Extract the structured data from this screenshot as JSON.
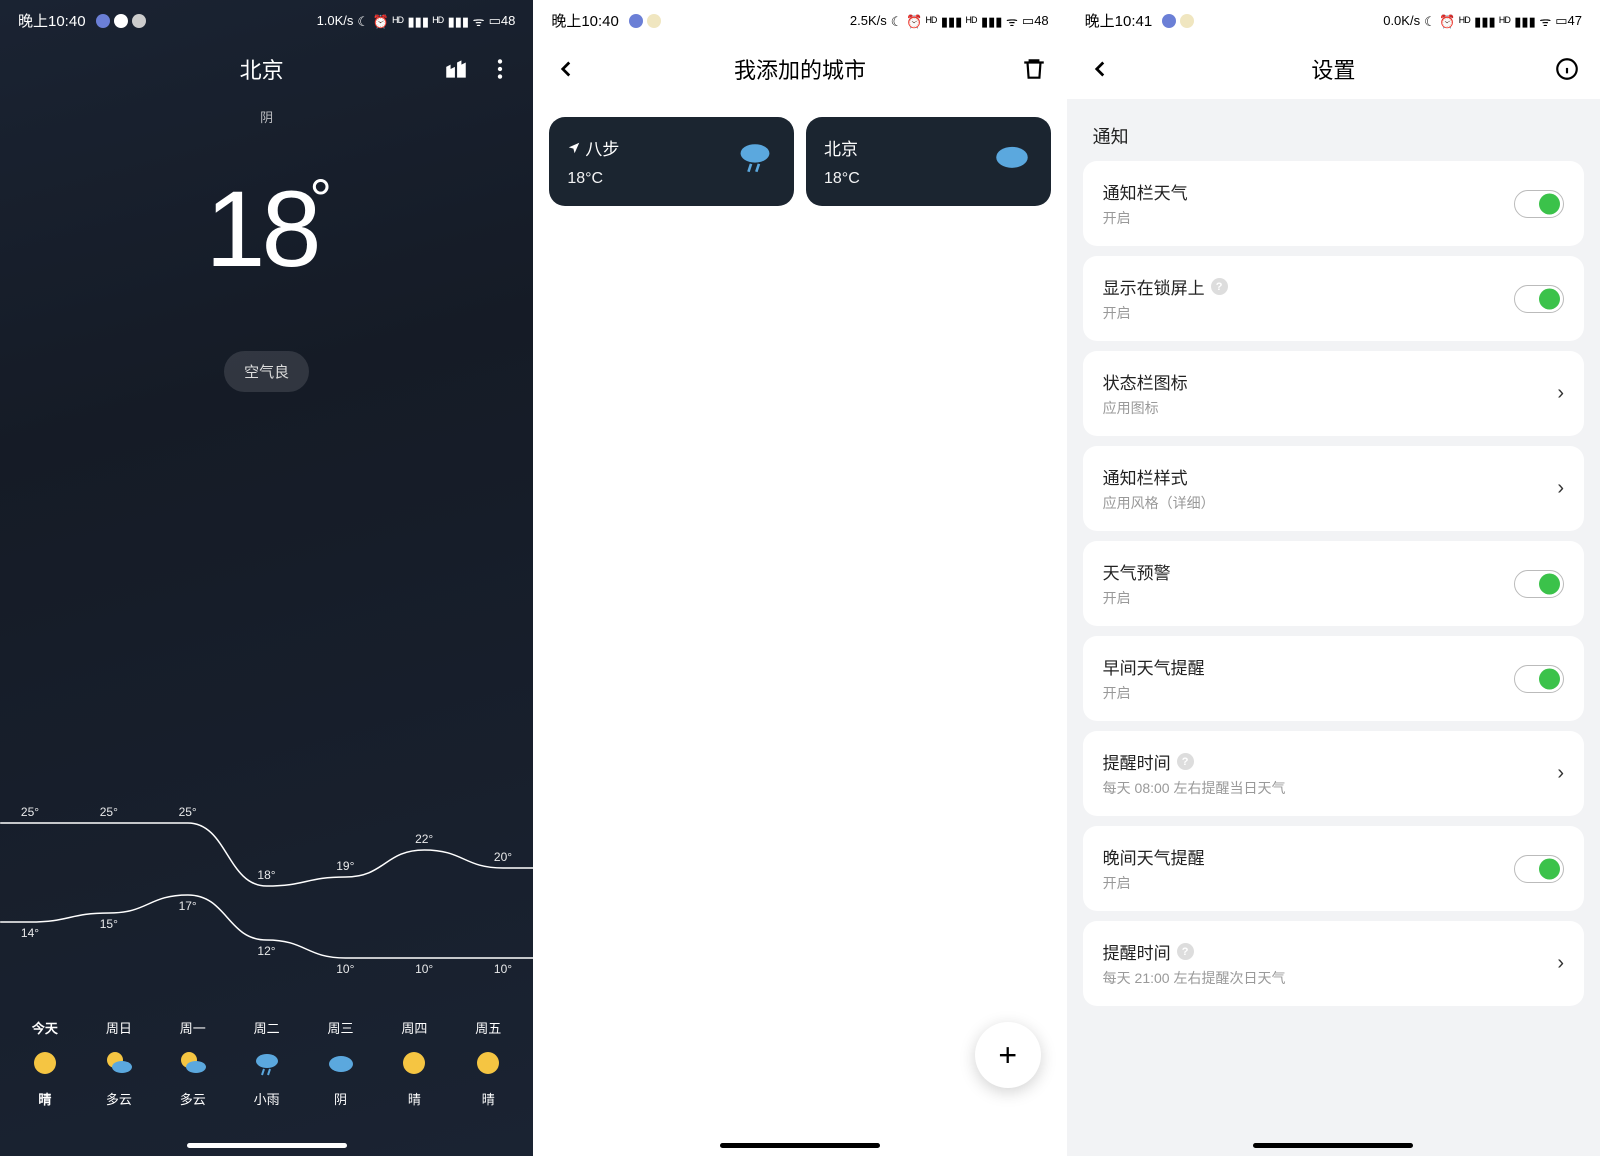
{
  "screen1": {
    "status": {
      "time": "晚上10:40",
      "speed": "1.0K/s",
      "battery": "48"
    },
    "city": "北京",
    "condition": "阴",
    "temp": "18",
    "air": "空气良",
    "chart_data": {
      "type": "line",
      "days": [
        "今天",
        "周日",
        "周一",
        "周二",
        "周三",
        "周四",
        "周五"
      ],
      "high": [
        25,
        25,
        25,
        18,
        19,
        22,
        20
      ],
      "low": [
        14,
        15,
        17,
        12,
        10,
        10,
        10
      ],
      "ylim": [
        8,
        28
      ]
    },
    "forecast": [
      {
        "day": "今天",
        "cond": "晴",
        "icon": "sun"
      },
      {
        "day": "周日",
        "cond": "多云",
        "icon": "partly"
      },
      {
        "day": "周一",
        "cond": "多云",
        "icon": "partly"
      },
      {
        "day": "周二",
        "cond": "小雨",
        "icon": "rain"
      },
      {
        "day": "周三",
        "cond": "阴",
        "icon": "cloud"
      },
      {
        "day": "周四",
        "cond": "晴",
        "icon": "sun"
      },
      {
        "day": "周五",
        "cond": "晴",
        "icon": "sun"
      }
    ]
  },
  "screen2": {
    "status": {
      "time": "晚上10:40",
      "speed": "2.5K/s",
      "battery": "48"
    },
    "title": "我添加的城市",
    "cities": [
      {
        "name": "八步",
        "temp": "18°C",
        "icon": "rain"
      },
      {
        "name": "北京",
        "temp": "18°C",
        "icon": "cloud"
      }
    ]
  },
  "screen3": {
    "status": {
      "time": "晚上10:41",
      "speed": "0.0K/s",
      "battery": "47"
    },
    "title": "设置",
    "section": "通知",
    "rows": [
      {
        "title": "通知栏天气",
        "sub": "开启",
        "type": "toggle"
      },
      {
        "title": "显示在锁屏上",
        "sub": "开启",
        "type": "toggle",
        "help": true
      },
      {
        "title": "状态栏图标",
        "sub": "应用图标",
        "type": "nav"
      },
      {
        "title": "通知栏样式",
        "sub": "应用风格（详细）",
        "type": "nav"
      },
      {
        "title": "天气预警",
        "sub": "开启",
        "type": "toggle"
      },
      {
        "title": "早间天气提醒",
        "sub": "开启",
        "type": "toggle"
      },
      {
        "title": "提醒时间",
        "sub": "每天 08:00 左右提醒当日天气",
        "type": "nav",
        "help": true
      },
      {
        "title": "晚间天气提醒",
        "sub": "开启",
        "type": "toggle"
      },
      {
        "title": "提醒时间",
        "sub": "每天 21:00 左右提醒次日天气",
        "type": "nav",
        "help": true
      }
    ]
  }
}
